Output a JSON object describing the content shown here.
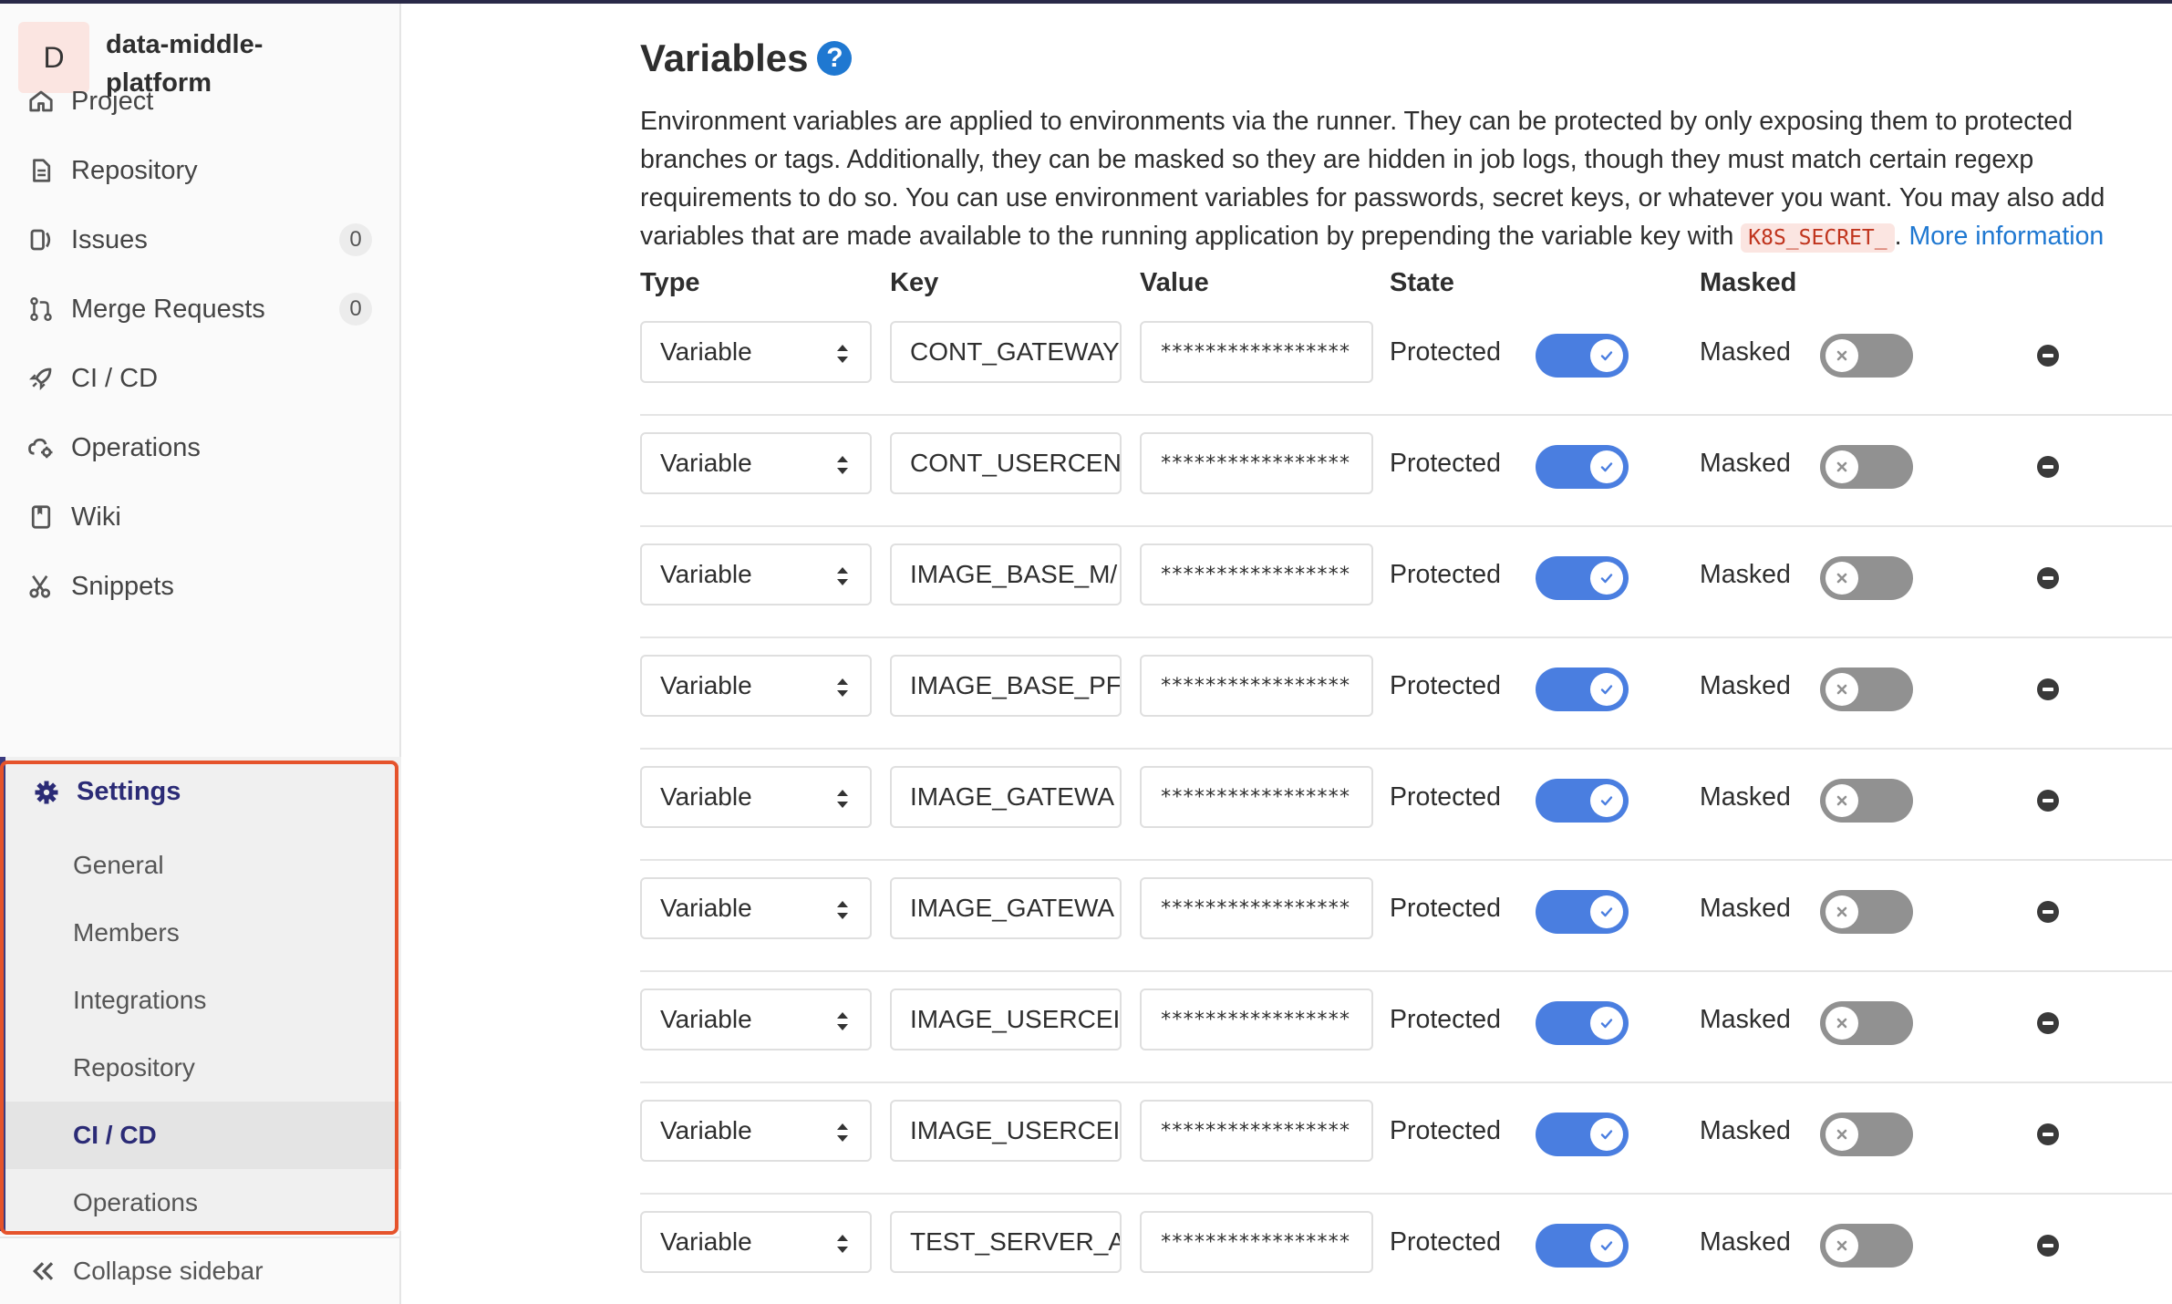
{
  "project": {
    "avatar_letter": "D",
    "name": "data-middle-platform"
  },
  "sidebar": {
    "items": [
      {
        "label": "Project",
        "icon": "home-icon"
      },
      {
        "label": "Repository",
        "icon": "document-icon"
      },
      {
        "label": "Issues",
        "icon": "issues-icon",
        "count": "0"
      },
      {
        "label": "Merge Requests",
        "icon": "merge-request-icon",
        "count": "0"
      },
      {
        "label": "CI / CD",
        "icon": "rocket-icon"
      },
      {
        "label": "Operations",
        "icon": "cloud-gear-icon"
      },
      {
        "label": "Wiki",
        "icon": "book-icon"
      },
      {
        "label": "Snippets",
        "icon": "scissors-icon"
      }
    ],
    "settings": {
      "label": "Settings",
      "icon": "gear-icon",
      "subitems": [
        {
          "label": "General"
        },
        {
          "label": "Members"
        },
        {
          "label": "Integrations"
        },
        {
          "label": "Repository"
        },
        {
          "label": "CI / CD",
          "active": true
        },
        {
          "label": "Operations"
        }
      ]
    },
    "collapse_label": "Collapse sidebar",
    "highlight_color": "#e5532b"
  },
  "variables": {
    "title": "Variables",
    "help_glyph": "?",
    "description": "Environment variables are applied to environments via the runner. They can be protected by only exposing them to protected branches or tags. Additionally, they can be masked so they are hidden in job logs, though they must match certain regexp requirements to do so. You can use environment variables for passwords, secret keys, or whatever you want. You may also add variables that are made available to the running application by prepending the variable key with ",
    "prefix_code": "K8S_SECRET_",
    "after_code": ".",
    "more_info": "More information",
    "columns": {
      "type": "Type",
      "key": "Key",
      "value": "Value",
      "state": "State",
      "masked": "Masked"
    },
    "rows": [
      {
        "type": "Variable",
        "key": "CONT_GATEWAY",
        "value": "*****************",
        "state": "Protected",
        "protected_on": true,
        "masked": "Masked",
        "masked_on": false
      },
      {
        "type": "Variable",
        "key": "CONT_USERCEN",
        "value": "*****************",
        "state": "Protected",
        "protected_on": true,
        "masked": "Masked",
        "masked_on": false
      },
      {
        "type": "Variable",
        "key": "IMAGE_BASE_M/",
        "value": "*****************",
        "state": "Protected",
        "protected_on": true,
        "masked": "Masked",
        "masked_on": false
      },
      {
        "type": "Variable",
        "key": "IMAGE_BASE_PF",
        "value": "*****************",
        "state": "Protected",
        "protected_on": true,
        "masked": "Masked",
        "masked_on": false
      },
      {
        "type": "Variable",
        "key": "IMAGE_GATEWA",
        "value": "*****************",
        "state": "Protected",
        "protected_on": true,
        "masked": "Masked",
        "masked_on": false
      },
      {
        "type": "Variable",
        "key": "IMAGE_GATEWA",
        "value": "*****************",
        "state": "Protected",
        "protected_on": true,
        "masked": "Masked",
        "masked_on": false
      },
      {
        "type": "Variable",
        "key": "IMAGE_USERCEI",
        "value": "*****************",
        "state": "Protected",
        "protected_on": true,
        "masked": "Masked",
        "masked_on": false
      },
      {
        "type": "Variable",
        "key": "IMAGE_USERCEI",
        "value": "*****************",
        "state": "Protected",
        "protected_on": true,
        "masked": "Masked",
        "masked_on": false
      },
      {
        "type": "Variable",
        "key": "TEST_SERVER_A",
        "value": "*****************",
        "state": "Protected",
        "protected_on": true,
        "masked": "Masked",
        "masked_on": false
      }
    ]
  },
  "colors": {
    "toggle_on": "#4a7ee0",
    "toggle_off": "#919191",
    "link": "#1f78d1",
    "active_nav": "#2b2b76"
  }
}
